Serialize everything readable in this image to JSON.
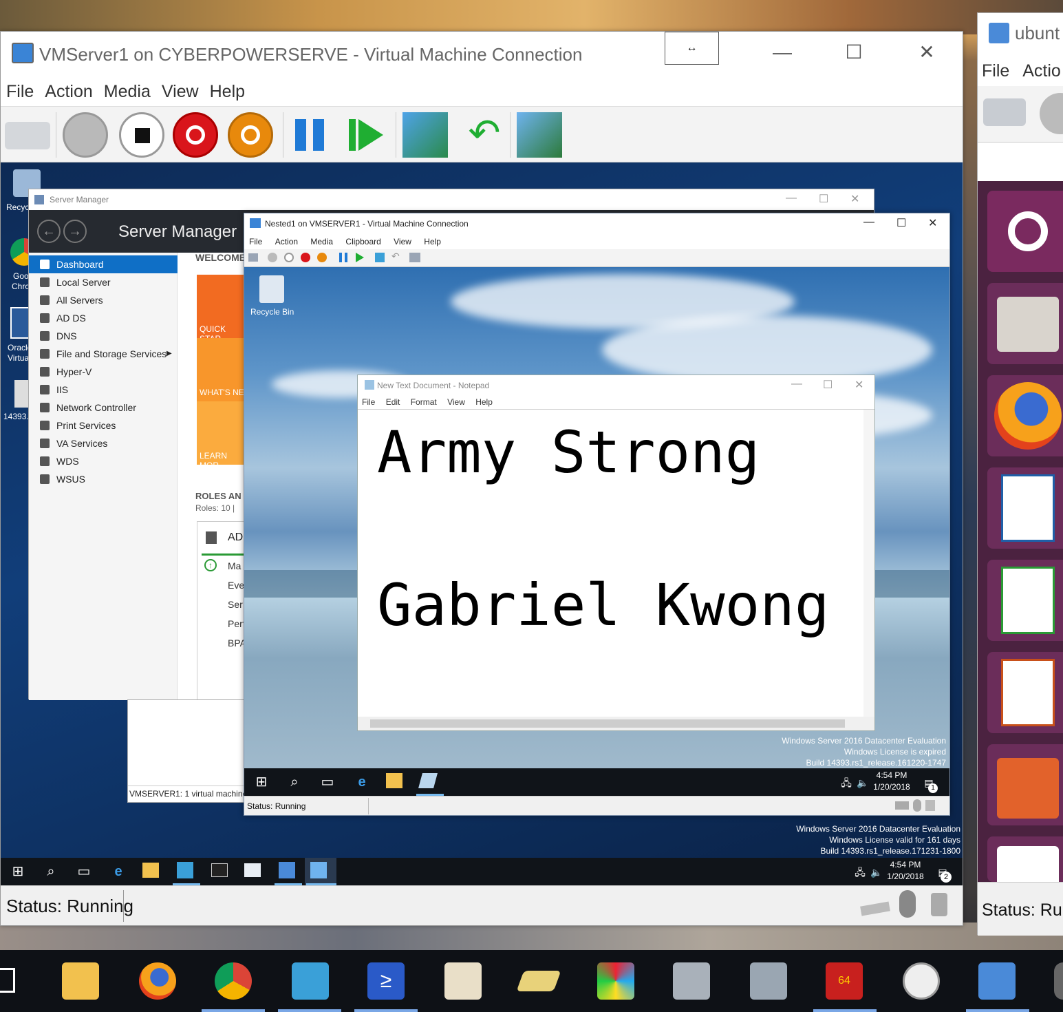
{
  "vm1": {
    "title": "VMServer1 on CYBERPOWERSERVE - Virtual Machine Connection",
    "menu": [
      "File",
      "Action",
      "Media",
      "View",
      "Help"
    ],
    "status": "Status: Running",
    "desktop_icons": [
      "Recyc",
      "Goo",
      "Chro",
      "Oracle",
      "Virtua",
      "14393.0"
    ],
    "watermark": [
      "Windows Server 2016 Datacenter Evaluation",
      "Windows License valid for 161 days",
      "Build 14393.rs1_release.171231-1800"
    ],
    "clock_time": "4:54 PM",
    "clock_date": "1/20/2018",
    "notif_count": "2"
  },
  "server_manager": {
    "window_title": "Server Manager",
    "header": "Server Manager",
    "nav": [
      "Dashboard",
      "Local Server",
      "All Servers",
      "AD DS",
      "DNS",
      "File and Storage Services",
      "Hyper-V",
      "IIS",
      "Network Controller",
      "Print Services",
      "VA Services",
      "WDS",
      "WSUS"
    ],
    "welcome": "WELCOME",
    "tiles": [
      "QUICK STAR",
      "WHAT'S NE",
      "LEARN MOR"
    ],
    "roles_heading": "ROLES AN",
    "roles_count": "Roles: 10  |",
    "role_card": "AD",
    "role_rows": [
      "Ma",
      "Eve",
      "Ser",
      "Perf",
      "BPA"
    ],
    "hyperv_status": "VMSERVER1:  1 virtual machine"
  },
  "vm2": {
    "title": "Nested1 on VMSERVER1 - Virtual Machine Connection",
    "menu": [
      "File",
      "Action",
      "Media",
      "Clipboard",
      "View",
      "Help"
    ],
    "status": "Status: Running",
    "recycle_bin": "Recycle Bin",
    "watermark": [
      "Windows Server 2016 Datacenter Evaluation",
      "Windows License is expired",
      "Build 14393.rs1_release.161220-1747"
    ],
    "clock_time": "4:54 PM",
    "clock_date": "1/20/2018",
    "notif_count": "1"
  },
  "notepad": {
    "title": "New Text Document - Notepad",
    "menu": [
      "File",
      "Edit",
      "Format",
      "View",
      "Help"
    ],
    "line1": "Army Strong",
    "line2": "Gabriel Kwong"
  },
  "ubuntu_window": {
    "title": "ubunt",
    "menu": [
      "File",
      "Actio"
    ],
    "status": "Status: Ru"
  },
  "colors": {
    "sm_active": "#0f6fc6",
    "stop_red": "#d9151b",
    "power_orange": "#e8890c",
    "play_green": "#1fae32",
    "pause_blue": "#1f7ad6"
  }
}
